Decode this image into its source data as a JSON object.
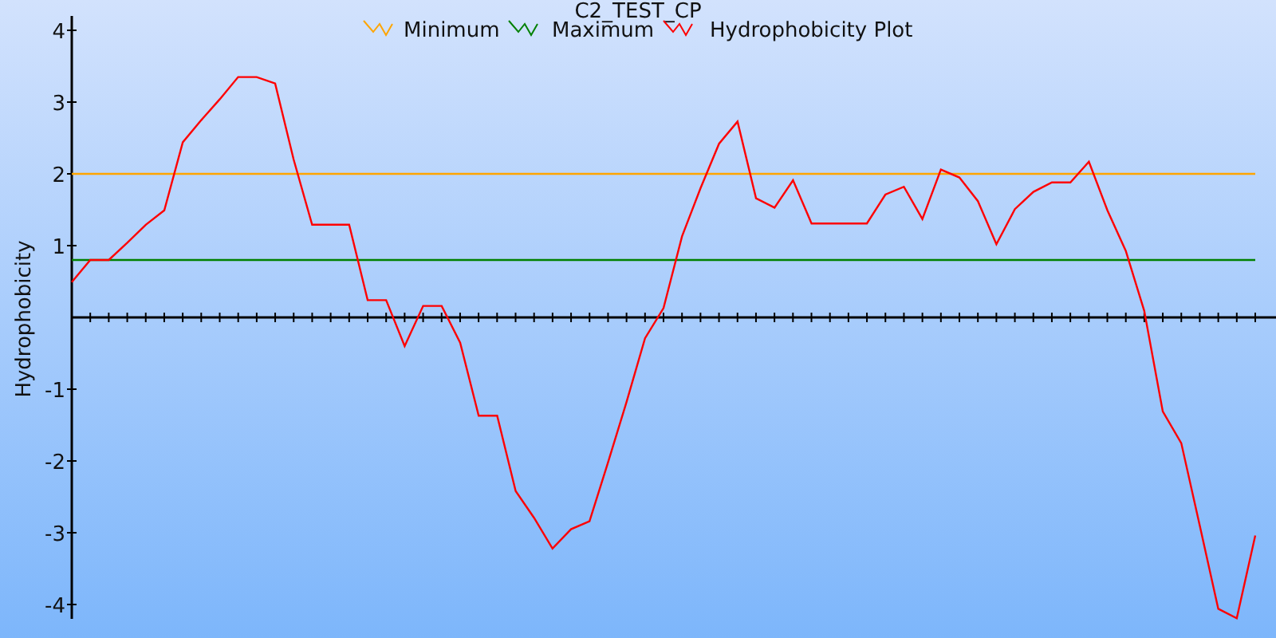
{
  "chart_data": {
    "type": "line",
    "title": "C2_TEST_CP",
    "ylabel": "Hydrophobicity",
    "legend": true,
    "ylim": [
      -4.2,
      4.2
    ],
    "yticks": [
      -4,
      -3,
      -2,
      -1,
      1,
      2,
      3,
      4
    ],
    "series": [
      {
        "name": "Minimum",
        "color": "#ffa500",
        "values": [
          2,
          2,
          2,
          2,
          2,
          2,
          2,
          2,
          2,
          2,
          2,
          2,
          2,
          2,
          2,
          2,
          2,
          2,
          2,
          2,
          2,
          2,
          2,
          2,
          2,
          2,
          2,
          2,
          2,
          2,
          2,
          2,
          2,
          2,
          2,
          2,
          2,
          2,
          2,
          2,
          2,
          2,
          2,
          2,
          2,
          2,
          2,
          2,
          2,
          2,
          2,
          2,
          2,
          2,
          2,
          2,
          2,
          2,
          2,
          2,
          2,
          2,
          2,
          2,
          2
        ]
      },
      {
        "name": "Maximum",
        "color": "#008000",
        "values": [
          0.8,
          0.8,
          0.8,
          0.8,
          0.8,
          0.8,
          0.8,
          0.8,
          0.8,
          0.8,
          0.8,
          0.8,
          0.8,
          0.8,
          0.8,
          0.8,
          0.8,
          0.8,
          0.8,
          0.8,
          0.8,
          0.8,
          0.8,
          0.8,
          0.8,
          0.8,
          0.8,
          0.8,
          0.8,
          0.8,
          0.8,
          0.8,
          0.8,
          0.8,
          0.8,
          0.8,
          0.8,
          0.8,
          0.8,
          0.8,
          0.8,
          0.8,
          0.8,
          0.8,
          0.8,
          0.8,
          0.8,
          0.8,
          0.8,
          0.8,
          0.8,
          0.8,
          0.8,
          0.8,
          0.8,
          0.8,
          0.8,
          0.8,
          0.8,
          0.8,
          0.8,
          0.8,
          0.8,
          0.8,
          0.8
        ]
      },
      {
        "name": "Hydrophobicity Plot",
        "color": "#ff0000",
        "values": [
          0.49,
          0.8,
          0.8,
          1.04,
          1.29,
          1.49,
          2.44,
          2.75,
          3.04,
          3.35,
          3.35,
          3.26,
          2.2,
          1.29,
          1.29,
          1.29,
          0.24,
          0.24,
          -0.4,
          0.16,
          0.16,
          -0.35,
          -1.37,
          -1.37,
          -2.42,
          -2.79,
          -3.22,
          -2.95,
          -2.84,
          -2.02,
          -1.18,
          -0.29,
          0.13,
          1.13,
          1.8,
          2.42,
          2.73,
          1.66,
          1.53,
          1.91,
          1.31,
          1.31,
          1.31,
          1.31,
          1.71,
          1.82,
          1.37,
          2.06,
          1.95,
          1.62,
          1.02,
          1.51,
          1.75,
          1.88,
          1.88,
          2.17,
          1.49,
          0.93,
          0.09,
          -1.31,
          -1.75,
          -2.9,
          -4.06,
          -4.19,
          -3.04
        ]
      }
    ]
  }
}
